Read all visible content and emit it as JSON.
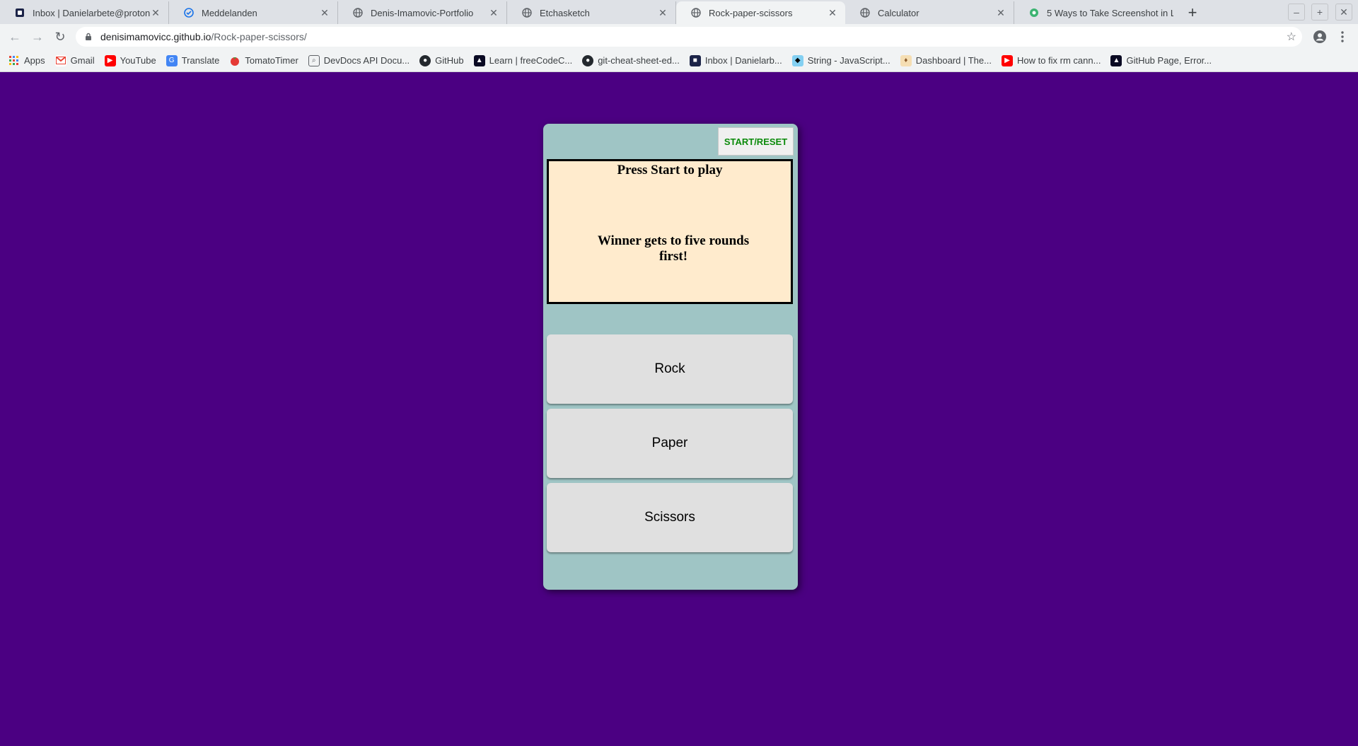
{
  "browser": {
    "tabs": [
      {
        "title": "Inbox | Danielarbete@protonm",
        "icon": "proton-icon",
        "active": false
      },
      {
        "title": "Meddelanden",
        "icon": "check-circle-icon",
        "active": false
      },
      {
        "title": "Denis-Imamovic-Portfolio",
        "icon": "globe-icon",
        "active": false
      },
      {
        "title": "Etchasketch",
        "icon": "globe-icon",
        "active": false
      },
      {
        "title": "Rock-paper-scissors",
        "icon": "globe-icon",
        "active": true
      },
      {
        "title": "Calculator",
        "icon": "globe-icon",
        "active": false
      },
      {
        "title": "5 Ways to Take Screenshot in Li",
        "icon": "green-circle-icon",
        "active": false
      }
    ],
    "url_domain": "denisimamovicc.github.io",
    "url_path": "/Rock-paper-scissors/",
    "bookmarks": [
      {
        "label": "Apps",
        "icon": "apps-grid-icon"
      },
      {
        "label": "Gmail",
        "icon": "gmail-icon"
      },
      {
        "label": "YouTube",
        "icon": "youtube-icon"
      },
      {
        "label": "Translate",
        "icon": "translate-icon"
      },
      {
        "label": "TomatoTimer",
        "icon": "tomato-icon"
      },
      {
        "label": "DevDocs API Docu...",
        "icon": "devdocs-icon"
      },
      {
        "label": "GitHub",
        "icon": "github-icon"
      },
      {
        "label": "Learn | freeCodeC...",
        "icon": "freecodecamp-icon"
      },
      {
        "label": "git-cheat-sheet-ed...",
        "icon": "github-icon"
      },
      {
        "label": "Inbox | Danielarb...",
        "icon": "proton-icon"
      },
      {
        "label": "String - JavaScript...",
        "icon": "mdn-icon"
      },
      {
        "label": "Dashboard | The...",
        "icon": "odin-icon"
      },
      {
        "label": "How to fix rm cann...",
        "icon": "youtube-icon"
      },
      {
        "label": "GitHub Page, Error...",
        "icon": "freecodecamp-icon"
      }
    ]
  },
  "game": {
    "start_label": "START/RESET",
    "message_primary": "Press Start to play",
    "message_secondary": "Winner gets to five rounds first!",
    "choices": [
      {
        "label": "Rock"
      },
      {
        "label": "Paper"
      },
      {
        "label": "Scissors"
      }
    ]
  },
  "colors": {
    "page_background": "#4b0082",
    "panel_background": "#9fc5c5",
    "message_background": "#ffebcd",
    "start_text": "#0a8a0a",
    "choice_button": "#e0e0e0"
  }
}
